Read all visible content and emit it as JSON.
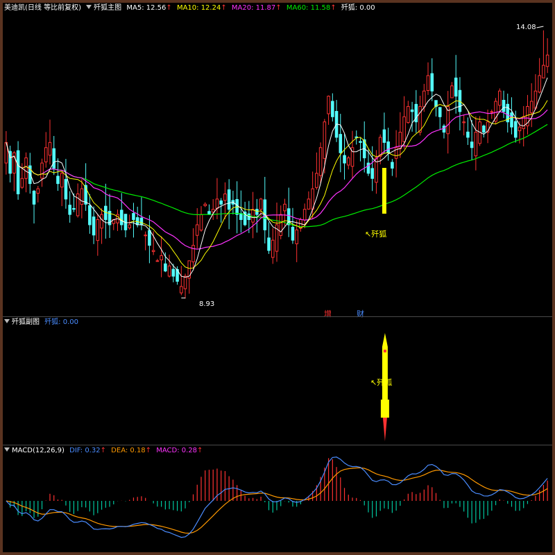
{
  "main": {
    "stock_name": "美迪凯",
    "period_desc": "(日线 等比前复权)",
    "indicator_name": "歼狐主图",
    "ma": [
      {
        "label": "MA5: 12.56",
        "color": "#ffffff"
      },
      {
        "label": "MA10: 12.24",
        "color": "#ffff00"
      },
      {
        "label": "MA20: 11.87",
        "color": "#ff33ff"
      },
      {
        "label": "MA60: 11.58",
        "color": "#00ee00"
      }
    ],
    "signal_value": "歼狐: 0.00",
    "up_arrow": "↑",
    "high_label": "14.08",
    "low_label": "8.93",
    "signal_label": "歼狐",
    "event_tag_1": "增",
    "event_tag_2": "财"
  },
  "sub": {
    "title": "歼狐副图",
    "value": "歼狐: 0.00",
    "signal_label": "歼狐"
  },
  "macd": {
    "title": "MACD(12,26,9)",
    "dif": "DIF: 0.32",
    "dea": "DEA: 0.18",
    "macd": "MACD: 0.28",
    "up_arrow": "↑"
  },
  "colors": {
    "up": "#ff3232",
    "down": "#54ffff",
    "ma5": "#ffffff",
    "ma10": "#ffff00",
    "ma20": "#ff33ff",
    "ma60": "#00ee00",
    "dif": "#4a8cff",
    "dea": "#ff9900",
    "signal": "#ffff00"
  },
  "chart_data": [
    {
      "type": "candlestick",
      "title": "美迪凯 (日线 等比前复权)",
      "ylim": [
        8.6,
        14.4
      ],
      "close": [
        11.9,
        11.3,
        11.7,
        10.9,
        11.2,
        11.6,
        11.1,
        10.7,
        11.0,
        11.5,
        11.8,
        11.9,
        11.4,
        11.1,
        11.3,
        10.8,
        10.5,
        10.6,
        10.9,
        11.0,
        10.7,
        10.3,
        10.1,
        10.4,
        10.5,
        10.4,
        10.3,
        10.4,
        10.5,
        10.3,
        10.2,
        10.3,
        10.4,
        10.3,
        10.3,
        10.1,
        9.9,
        9.8,
        9.6,
        9.7,
        9.4,
        9.5,
        9.3,
        9.2,
        9.1,
        9.3,
        9.6,
        9.9,
        10.3,
        10.5,
        10.7,
        10.5,
        10.6,
        10.8,
        10.7,
        10.9,
        10.6,
        10.7,
        10.5,
        10.4,
        10.3,
        10.4,
        10.6,
        10.5,
        10.8,
        10.2,
        9.8,
        10.0,
        10.3,
        10.5,
        10.7,
        10.3,
        10.0,
        10.2,
        10.4,
        10.6,
        10.8,
        11.0,
        11.3,
        11.8,
        12.3,
        12.8,
        12.4,
        12.0,
        11.7,
        11.5,
        11.6,
        11.8,
        12.0,
        11.9,
        11.6,
        11.3,
        11.2,
        11.6,
        12.0,
        11.9,
        11.7,
        11.4,
        11.8,
        12.1,
        12.4,
        12.6,
        12.5,
        12.3,
        12.6,
        12.9,
        13.2,
        12.9,
        12.6,
        12.4,
        12.1,
        12.6,
        13.0,
        12.8,
        12.5,
        12.3,
        12.0,
        11.8,
        12.1,
        12.3,
        12.1,
        12.3,
        12.5,
        12.7,
        12.9,
        12.5,
        12.3,
        12.2,
        12.0,
        12.2,
        12.4,
        12.6,
        12.7,
        12.9,
        13.2,
        13.4,
        13.6
      ]
    },
    {
      "type": "line",
      "title": "MACD(12,26,9)",
      "series": [
        {
          "name": "DIF",
          "values": []
        },
        {
          "name": "DEA",
          "values": []
        },
        {
          "name": "MACD",
          "values": []
        }
      ]
    }
  ]
}
